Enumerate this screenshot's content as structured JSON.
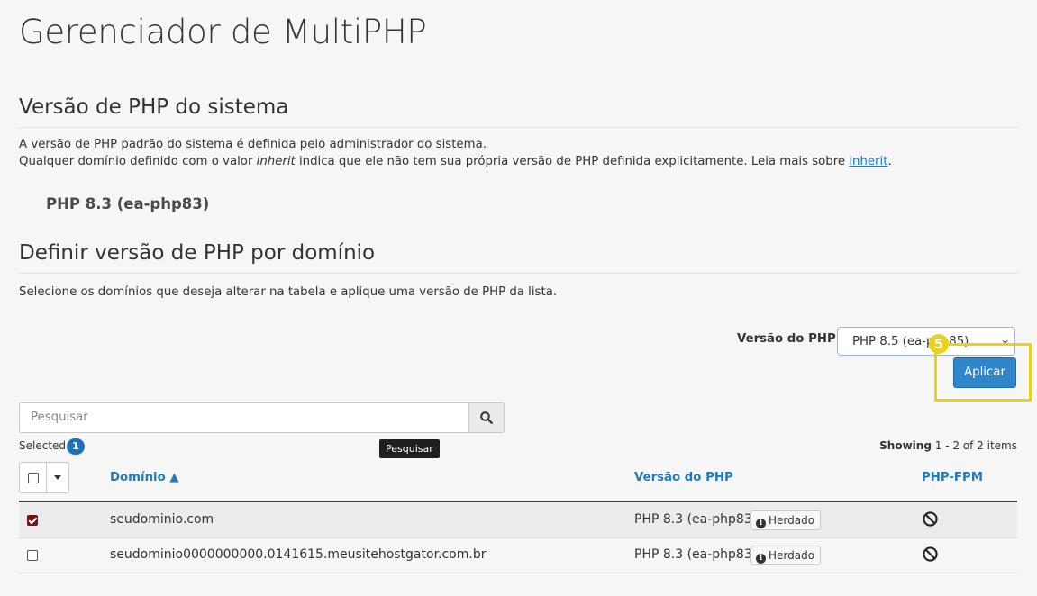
{
  "page": {
    "title": "Gerenciador de MultiPHP"
  },
  "system_section": {
    "heading": "Versão de PHP do sistema",
    "line1": "A versão de PHP padrão do sistema é definida pelo administrador do sistema.",
    "line2_pre": "Qualquer domínio definido com o valor ",
    "line2_em": "inherit",
    "line2_mid": " indica que ele não tem sua própria versão de PHP definida explicitamente. Leia mais sobre ",
    "line2_link": "inherit",
    "line2_post": ".",
    "system_version": "PHP 8.3 (ea-php83)"
  },
  "domain_section": {
    "heading": "Definir versão de PHP por domínio",
    "description": "Selecione os domínios que deseja alterar na tabela e aplique uma versão de PHP da lista.",
    "php_version_label": "Versão do PHP",
    "php_version_selected": "PHP 8.5 (ea-php85)",
    "apply_button": "Aplicar",
    "step_badge": "5"
  },
  "search": {
    "placeholder": "Pesquisar",
    "tooltip": "Pesquisar"
  },
  "table_meta": {
    "selected_label": "Selected",
    "selected_count": "1",
    "showing_label": "Showing",
    "showing_range": "1 - 2 of 2 items"
  },
  "table": {
    "columns": {
      "domain": "Domínio ▲",
      "php_version": "Versão do PHP",
      "php_fpm": "PHP-FPM"
    },
    "rows": [
      {
        "domain": "seudominio.com",
        "php_version": "PHP 8.3 (ea-php83)",
        "badge": "Herdado",
        "checked": true
      },
      {
        "domain": "seudominio0000000000.0141615.meusitehostgator.com.br",
        "php_version": "PHP 8.3 (ea-php83)",
        "badge": "Herdado",
        "checked": false
      }
    ]
  },
  "colors": {
    "accent": "#2f86cb",
    "link": "#1f7abf",
    "highlight": "#ecd118",
    "checkbox_checked": "#7a1212"
  },
  "icons": {
    "search": "search-icon",
    "info": "info-icon",
    "disabled": "ban-icon",
    "dropdown": "chevron-down-icon"
  }
}
